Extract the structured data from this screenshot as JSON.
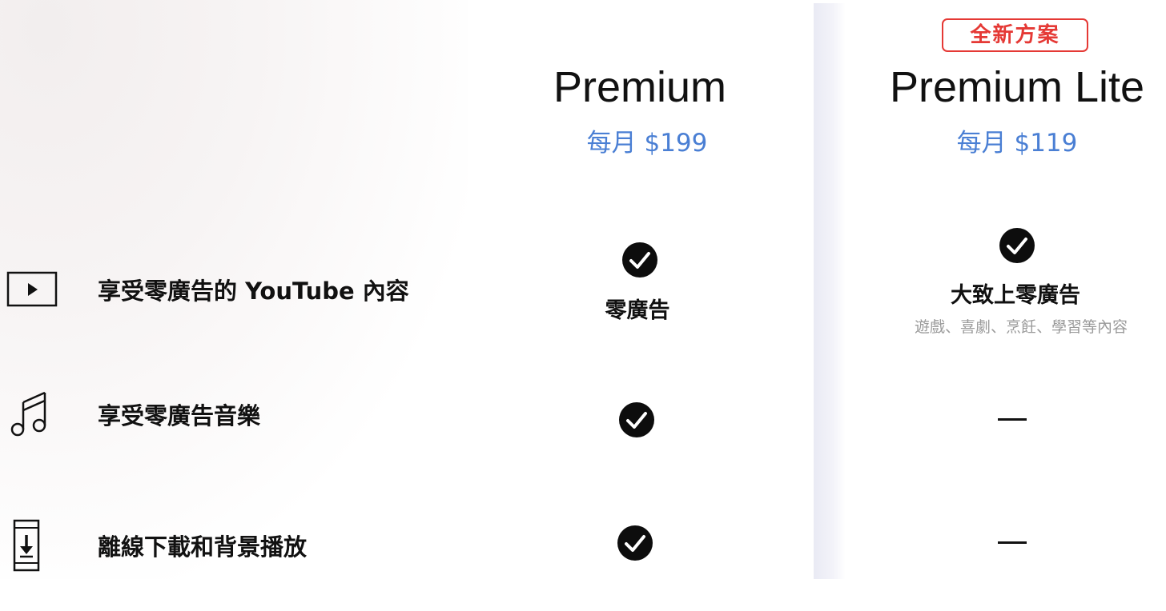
{
  "features": [
    {
      "label": "享受零廣告的 YouTube 內容",
      "icon": "play-box-icon"
    },
    {
      "label": "享受零廣告音樂",
      "icon": "music-note-icon"
    },
    {
      "label": "離線下載和背景播放",
      "icon": "download-phone-icon"
    }
  ],
  "plans": {
    "premium": {
      "name": "Premium",
      "price": "每月 $199",
      "ads_label": "零廣告"
    },
    "lite": {
      "badge": "全新方案",
      "name": "Premium Lite",
      "price": "每月 $119",
      "ads_label": "大致上零廣告",
      "ads_sub": "遊戲、喜劇、烹飪、學習等內容",
      "music_value": "—",
      "offline_value": "—"
    }
  },
  "colors": {
    "price": "#4a7fd4",
    "badge": "#e53935",
    "text": "#111111",
    "subtext": "#9a9a9a"
  }
}
